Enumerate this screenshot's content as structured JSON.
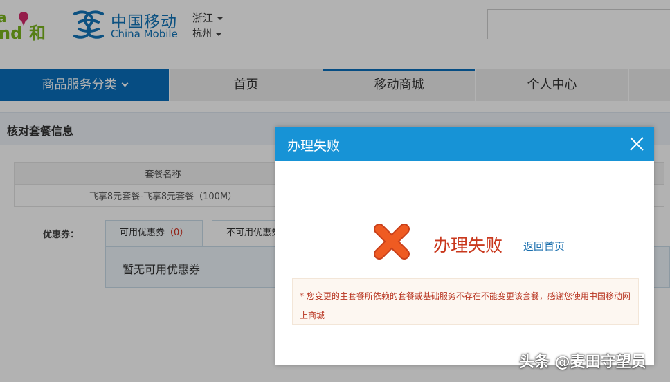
{
  "header": {
    "brand_logo_text": "and和",
    "logo_cn": "中国移动",
    "logo_en": "China Mobile",
    "province": "浙江",
    "city": "杭州"
  },
  "nav": {
    "items": [
      {
        "label": "商品服务分类"
      },
      {
        "label": "首页"
      },
      {
        "label": "移动商城"
      },
      {
        "label": "个人中心"
      }
    ]
  },
  "section": {
    "title": "核对套餐信息"
  },
  "package_table": {
    "header": "套餐名称",
    "row": "飞享8元套餐-飞享8元套餐（100M）"
  },
  "coupons": {
    "label": "优惠券：",
    "tab_available": "可用优惠券",
    "tab_available_count": "（0）",
    "tab_unavailable": "不可用优惠券",
    "empty_text": "暂无可用优惠券"
  },
  "dialog": {
    "title": "办理失败",
    "status": "办理失败",
    "back_link": "返回首页",
    "notice": "* 您变更的主套餐所依赖的套餐或基础服务不存在不能变更该套餐，感谢您使用中国移动网上商城"
  },
  "watermark": "头条 @麦田守望员",
  "colors": {
    "brand_blue": "#0a6fbc",
    "dialog_header": "#1793d6",
    "error_red": "#c9381d",
    "fail_icon": "#e8541f"
  }
}
